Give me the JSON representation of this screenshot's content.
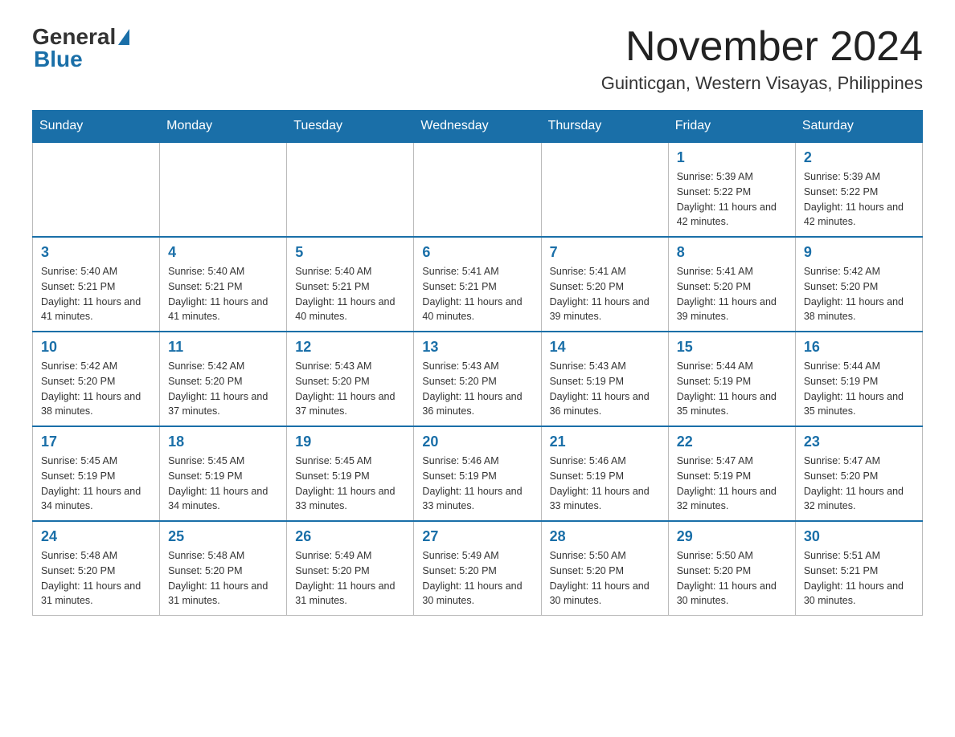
{
  "logo": {
    "general": "General",
    "blue": "Blue"
  },
  "header": {
    "month": "November 2024",
    "location": "Guinticgan, Western Visayas, Philippines"
  },
  "days_of_week": [
    "Sunday",
    "Monday",
    "Tuesday",
    "Wednesday",
    "Thursday",
    "Friday",
    "Saturday"
  ],
  "weeks": [
    {
      "days": [
        {
          "num": "",
          "info": ""
        },
        {
          "num": "",
          "info": ""
        },
        {
          "num": "",
          "info": ""
        },
        {
          "num": "",
          "info": ""
        },
        {
          "num": "",
          "info": ""
        },
        {
          "num": "1",
          "info": "Sunrise: 5:39 AM\nSunset: 5:22 PM\nDaylight: 11 hours and 42 minutes."
        },
        {
          "num": "2",
          "info": "Sunrise: 5:39 AM\nSunset: 5:22 PM\nDaylight: 11 hours and 42 minutes."
        }
      ]
    },
    {
      "days": [
        {
          "num": "3",
          "info": "Sunrise: 5:40 AM\nSunset: 5:21 PM\nDaylight: 11 hours and 41 minutes."
        },
        {
          "num": "4",
          "info": "Sunrise: 5:40 AM\nSunset: 5:21 PM\nDaylight: 11 hours and 41 minutes."
        },
        {
          "num": "5",
          "info": "Sunrise: 5:40 AM\nSunset: 5:21 PM\nDaylight: 11 hours and 40 minutes."
        },
        {
          "num": "6",
          "info": "Sunrise: 5:41 AM\nSunset: 5:21 PM\nDaylight: 11 hours and 40 minutes."
        },
        {
          "num": "7",
          "info": "Sunrise: 5:41 AM\nSunset: 5:20 PM\nDaylight: 11 hours and 39 minutes."
        },
        {
          "num": "8",
          "info": "Sunrise: 5:41 AM\nSunset: 5:20 PM\nDaylight: 11 hours and 39 minutes."
        },
        {
          "num": "9",
          "info": "Sunrise: 5:42 AM\nSunset: 5:20 PM\nDaylight: 11 hours and 38 minutes."
        }
      ]
    },
    {
      "days": [
        {
          "num": "10",
          "info": "Sunrise: 5:42 AM\nSunset: 5:20 PM\nDaylight: 11 hours and 38 minutes."
        },
        {
          "num": "11",
          "info": "Sunrise: 5:42 AM\nSunset: 5:20 PM\nDaylight: 11 hours and 37 minutes."
        },
        {
          "num": "12",
          "info": "Sunrise: 5:43 AM\nSunset: 5:20 PM\nDaylight: 11 hours and 37 minutes."
        },
        {
          "num": "13",
          "info": "Sunrise: 5:43 AM\nSunset: 5:20 PM\nDaylight: 11 hours and 36 minutes."
        },
        {
          "num": "14",
          "info": "Sunrise: 5:43 AM\nSunset: 5:19 PM\nDaylight: 11 hours and 36 minutes."
        },
        {
          "num": "15",
          "info": "Sunrise: 5:44 AM\nSunset: 5:19 PM\nDaylight: 11 hours and 35 minutes."
        },
        {
          "num": "16",
          "info": "Sunrise: 5:44 AM\nSunset: 5:19 PM\nDaylight: 11 hours and 35 minutes."
        }
      ]
    },
    {
      "days": [
        {
          "num": "17",
          "info": "Sunrise: 5:45 AM\nSunset: 5:19 PM\nDaylight: 11 hours and 34 minutes."
        },
        {
          "num": "18",
          "info": "Sunrise: 5:45 AM\nSunset: 5:19 PM\nDaylight: 11 hours and 34 minutes."
        },
        {
          "num": "19",
          "info": "Sunrise: 5:45 AM\nSunset: 5:19 PM\nDaylight: 11 hours and 33 minutes."
        },
        {
          "num": "20",
          "info": "Sunrise: 5:46 AM\nSunset: 5:19 PM\nDaylight: 11 hours and 33 minutes."
        },
        {
          "num": "21",
          "info": "Sunrise: 5:46 AM\nSunset: 5:19 PM\nDaylight: 11 hours and 33 minutes."
        },
        {
          "num": "22",
          "info": "Sunrise: 5:47 AM\nSunset: 5:19 PM\nDaylight: 11 hours and 32 minutes."
        },
        {
          "num": "23",
          "info": "Sunrise: 5:47 AM\nSunset: 5:20 PM\nDaylight: 11 hours and 32 minutes."
        }
      ]
    },
    {
      "days": [
        {
          "num": "24",
          "info": "Sunrise: 5:48 AM\nSunset: 5:20 PM\nDaylight: 11 hours and 31 minutes."
        },
        {
          "num": "25",
          "info": "Sunrise: 5:48 AM\nSunset: 5:20 PM\nDaylight: 11 hours and 31 minutes."
        },
        {
          "num": "26",
          "info": "Sunrise: 5:49 AM\nSunset: 5:20 PM\nDaylight: 11 hours and 31 minutes."
        },
        {
          "num": "27",
          "info": "Sunrise: 5:49 AM\nSunset: 5:20 PM\nDaylight: 11 hours and 30 minutes."
        },
        {
          "num": "28",
          "info": "Sunrise: 5:50 AM\nSunset: 5:20 PM\nDaylight: 11 hours and 30 minutes."
        },
        {
          "num": "29",
          "info": "Sunrise: 5:50 AM\nSunset: 5:20 PM\nDaylight: 11 hours and 30 minutes."
        },
        {
          "num": "30",
          "info": "Sunrise: 5:51 AM\nSunset: 5:21 PM\nDaylight: 11 hours and 30 minutes."
        }
      ]
    }
  ]
}
